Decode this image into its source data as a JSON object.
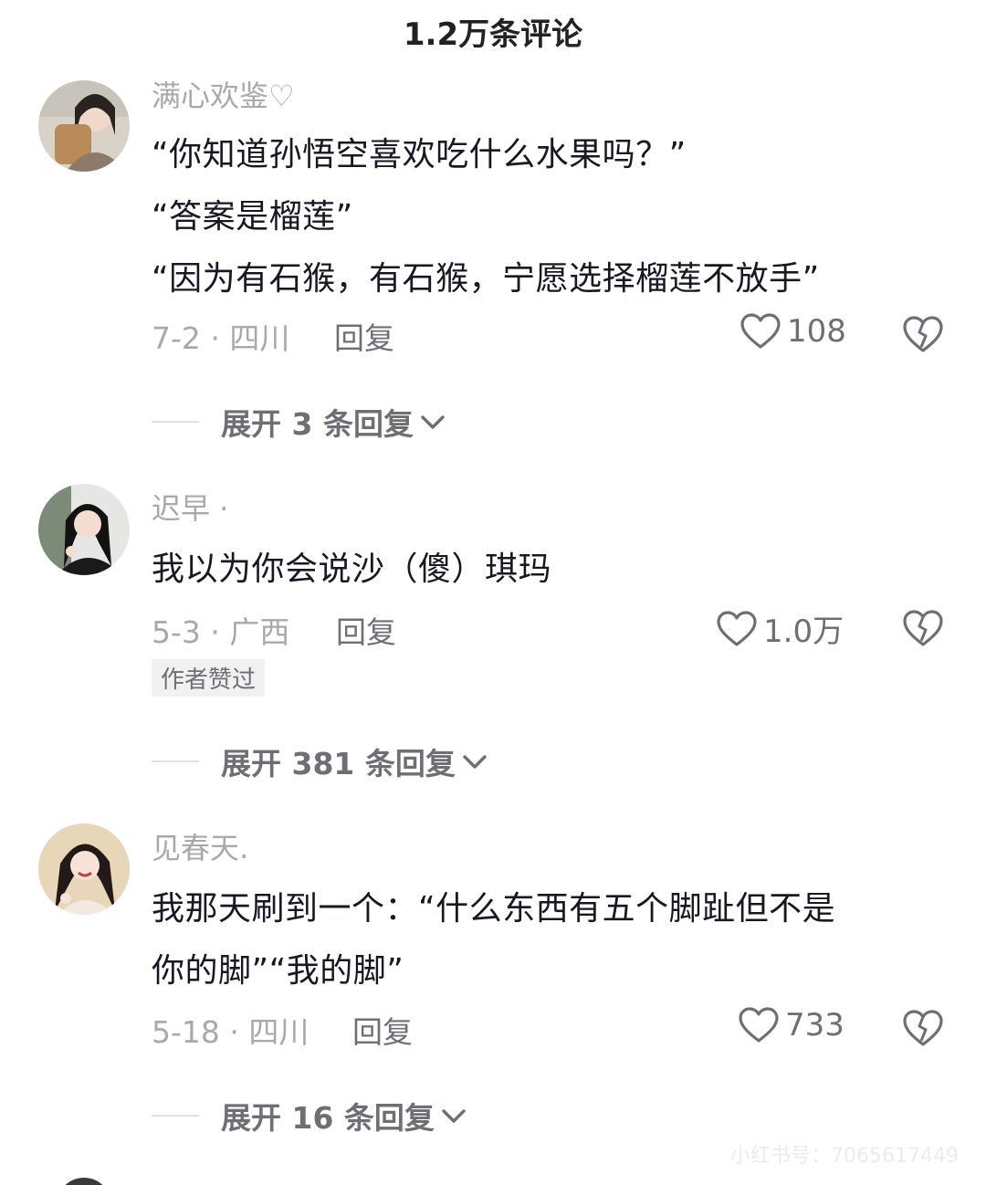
{
  "header": {
    "title": "1.2万条评论"
  },
  "comments": [
    {
      "username": "满心欢鉴♡",
      "lines": [
        "“你知道孙悟空喜欢吃什么水果吗？”",
        "“答案是榴莲”",
        "“因为有石猴，有石猴，宁愿选择榴莲不放手”"
      ],
      "date_location": "7-2 · 四川",
      "reply_label": "回复",
      "likes": "108",
      "expand_label": "展开 3 条回复"
    },
    {
      "username": "迟早 ·",
      "lines": [
        "我以为你会说沙（傻）琪玛"
      ],
      "date_location": "5-3 · 广西",
      "reply_label": "回复",
      "likes": "1.0万",
      "author_badge": "作者赞过",
      "expand_label": "展开 381 条回复"
    },
    {
      "username": "见春天.",
      "lines": [
        "我那天刷到一个：“什么东西有五个脚趾但不是",
        "你的脚”“我的脚”"
      ],
      "date_location": "5-18 · 四川",
      "reply_label": "回复",
      "likes": "733",
      "expand_label": "展开 16 条回复"
    }
  ],
  "watermark": "小红书号：7065617449",
  "icons": {
    "like": "heart-outline-icon",
    "dislike": "broken-heart-icon",
    "expand": "chevron-down-icon"
  },
  "colors": {
    "text_primary": "#161823",
    "text_secondary": "#a8a9ad",
    "text_action": "#6e6f75"
  }
}
